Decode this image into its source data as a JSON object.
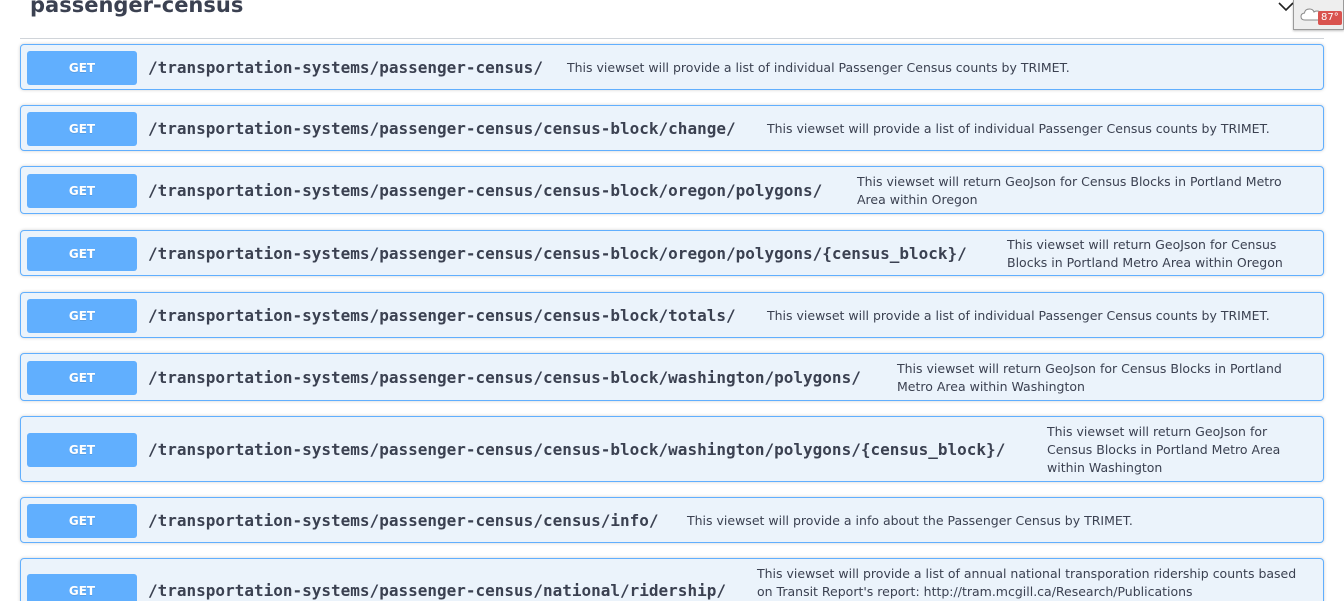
{
  "section": {
    "title": "passenger-census",
    "collapse_icon": "chevron-down-icon"
  },
  "weather_widget": {
    "icon": "cloud-icon",
    "temperature": "87°"
  },
  "operations": [
    {
      "method": "GET",
      "path": "/transportation-systems/passenger-census/",
      "description": "This viewset will provide a list of individual Passenger Census counts by TRIMET."
    },
    {
      "method": "GET",
      "path": "/transportation-systems/passenger-census/census-block/change/",
      "description": "This viewset will provide a list of individual Passenger Census counts by TRIMET."
    },
    {
      "method": "GET",
      "path": "/transportation-systems/passenger-census/census-block/oregon/polygons/",
      "description": "This viewset will return GeoJson for Census Blocks in Portland Metro Area within Oregon"
    },
    {
      "method": "GET",
      "path": "/transportation-systems/passenger-census/census-block/oregon/polygons/{census_block}/",
      "description": "This viewset will return GeoJson for Census Blocks in Portland Metro Area within Oregon"
    },
    {
      "method": "GET",
      "path": "/transportation-systems/passenger-census/census-block/totals/",
      "description": "This viewset will provide a list of individual Passenger Census counts by TRIMET."
    },
    {
      "method": "GET",
      "path": "/transportation-systems/passenger-census/census-block/washington/polygons/",
      "description": "This viewset will return GeoJson for Census Blocks in Portland Metro Area within Washington"
    },
    {
      "method": "GET",
      "path": "/transportation-systems/passenger-census/census-block/washington/polygons/{census_block}/",
      "description": "This viewset will return GeoJson for Census Blocks in Portland Metro Area within Washington"
    },
    {
      "method": "GET",
      "path": "/transportation-systems/passenger-census/census/info/",
      "description": "This viewset will provide a info about the Passenger Census by TRIMET."
    },
    {
      "method": "GET",
      "path": "/transportation-systems/passenger-census/national/ridership/",
      "description": "This viewset will provide a list of annual national transporation ridership counts based on Transit Report's report: http://tram.mcgill.ca/Research/Publications"
    }
  ]
}
